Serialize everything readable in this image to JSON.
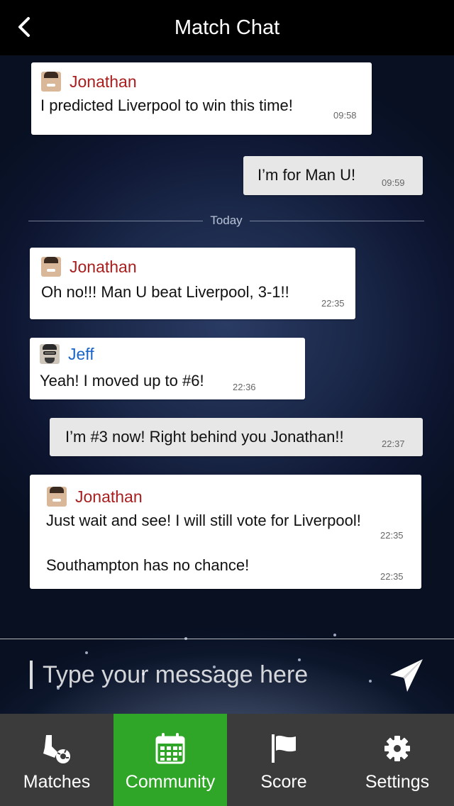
{
  "header": {
    "title": "Match Chat"
  },
  "messages": [
    {
      "sender": "Jonathan",
      "text": "I predicted Liverpool to win this time!",
      "time": "09:58"
    },
    {
      "text": "I’m for Man U!",
      "time": "09:59"
    },
    {
      "sender": "Jonathan",
      "text": "Oh no!!! Man U beat Liverpool, 3-1!!",
      "time": "22:35"
    },
    {
      "sender": "Jeff",
      "text": "Yeah! I moved up to #6!",
      "time": "22:36"
    },
    {
      "text": "I’m #3 now! Right behind you Jonathan!!",
      "time": "22:37"
    },
    {
      "sender": "Jonathan",
      "text": "Just wait and see! I will still vote for Liverpool!",
      "time": "22:35",
      "text2": "Southampton has no chance!",
      "time2": "22:35"
    }
  ],
  "divider": {
    "label": "Today"
  },
  "composer": {
    "placeholder": "Type your message here"
  },
  "tabs": [
    {
      "label": "Matches",
      "icon": "boot-ball-icon"
    },
    {
      "label": "Community",
      "icon": "calendar-icon",
      "active": true
    },
    {
      "label": "Score",
      "icon": "flag-icon"
    },
    {
      "label": "Settings",
      "icon": "gear-icon"
    }
  ],
  "colors": {
    "active_tab": "#2fa627",
    "tabbar": "#3b3b3b",
    "sender_red": "#a81e1e",
    "sender_blue": "#1a64c8"
  }
}
